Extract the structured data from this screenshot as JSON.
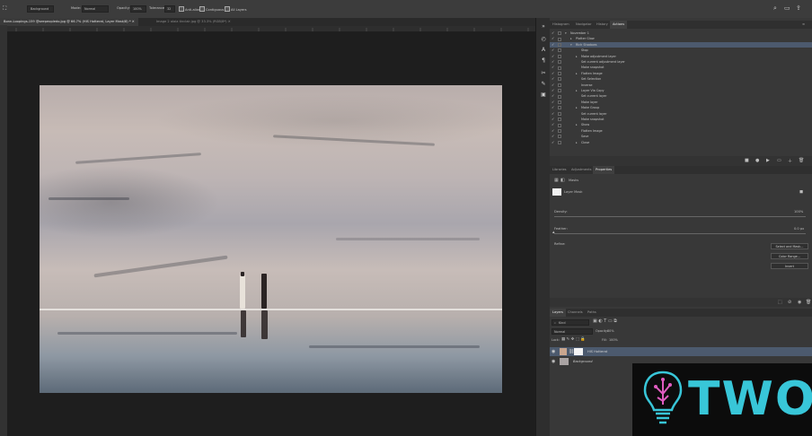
{
  "options_bar": {
    "tool_label": "Background",
    "mode_label": "Mode:",
    "mode_value": "Normal",
    "opacity_label": "Opacity:",
    "opacity_value": "100%",
    "tolerance_label": "Tolerance:",
    "tolerance_value": "32",
    "antialias_label": "Anti-alias",
    "contiguous_label": "Contiguous",
    "all_layers_label": "All Layers"
  },
  "tabs": [
    {
      "label": "Bonn-Loopings-159 @seepeopledo.jpg @ 66.7% (HIS Hotterat, Layer Mask/8) *",
      "active": true
    },
    {
      "label": "Image 2 alaia tinclair.jpg @ 33.3% (RGB/8*)",
      "active": false
    }
  ],
  "actions_panel": {
    "tabs": [
      "Histogram",
      "Navigator",
      "History",
      "Actions"
    ],
    "active_tab": "Actions",
    "items": [
      {
        "label": "November 1",
        "level": 0,
        "expanded": true,
        "checked": true
      },
      {
        "label": "Platter Glow",
        "level": 1,
        "expanded": false,
        "checked": true
      },
      {
        "label": "Rich Shadows",
        "level": 1,
        "expanded": true,
        "checked": true,
        "selected": true
      },
      {
        "label": "Stop",
        "level": 2,
        "checked": true
      },
      {
        "label": "Make adjustment layer",
        "level": 2,
        "checked": true
      },
      {
        "label": "Set current adjustment layer",
        "level": 2,
        "checked": true
      },
      {
        "label": "Make snapshot",
        "level": 2,
        "checked": true
      },
      {
        "label": "Flatten Image",
        "level": 2,
        "checked": true
      },
      {
        "label": "Set Selection",
        "level": 2,
        "checked": true
      },
      {
        "label": "Inverse",
        "level": 2,
        "checked": true
      },
      {
        "label": "Layer Via Copy",
        "level": 2,
        "checked": true
      },
      {
        "label": "Set current layer",
        "level": 2,
        "checked": true
      },
      {
        "label": "Make layer",
        "level": 2,
        "checked": true
      },
      {
        "label": "Make Group",
        "level": 2,
        "checked": true
      },
      {
        "label": "Set current layer",
        "level": 2,
        "checked": true
      },
      {
        "label": "Make snapshot",
        "level": 2,
        "checked": true
      },
      {
        "label": "Show",
        "level": 2,
        "checked": true
      },
      {
        "label": "Flatten Image",
        "level": 2,
        "checked": true
      },
      {
        "label": "Save",
        "level": 2,
        "checked": true
      },
      {
        "label": "Close",
        "level": 2,
        "checked": true
      }
    ]
  },
  "properties_panel": {
    "tabs": [
      "Libraries",
      "Adjustments",
      "Properties"
    ],
    "active_tab": "Properties",
    "section_label": "Masks",
    "mask_label": "Layer Mask",
    "density_label": "Density:",
    "density_value": "100%",
    "feather_label": "Feather:",
    "feather_value": "0.0 px",
    "refine_label": "Refine:",
    "buttons": [
      "Select and Mask...",
      "Color Range...",
      "Invert"
    ]
  },
  "layers_panel": {
    "tabs": [
      "Layers",
      "Channels",
      "Paths"
    ],
    "active_tab": "Layers",
    "filter_value": "Kind",
    "blend_mode": "Normal",
    "opacity_label": "Opacity:",
    "opacity_value": "80%",
    "lock_label": "Lock:",
    "fill_label": "Fill:",
    "fill_value": "100%",
    "layers": [
      {
        "name": "HIS Hotterat",
        "selected": true
      },
      {
        "name": "Background",
        "selected": false
      }
    ]
  },
  "watermark": {
    "text": "TWOS"
  },
  "colors": {
    "accent": "#38c6d8",
    "panel_bg": "#383838",
    "selection": "#4c5a6e"
  }
}
